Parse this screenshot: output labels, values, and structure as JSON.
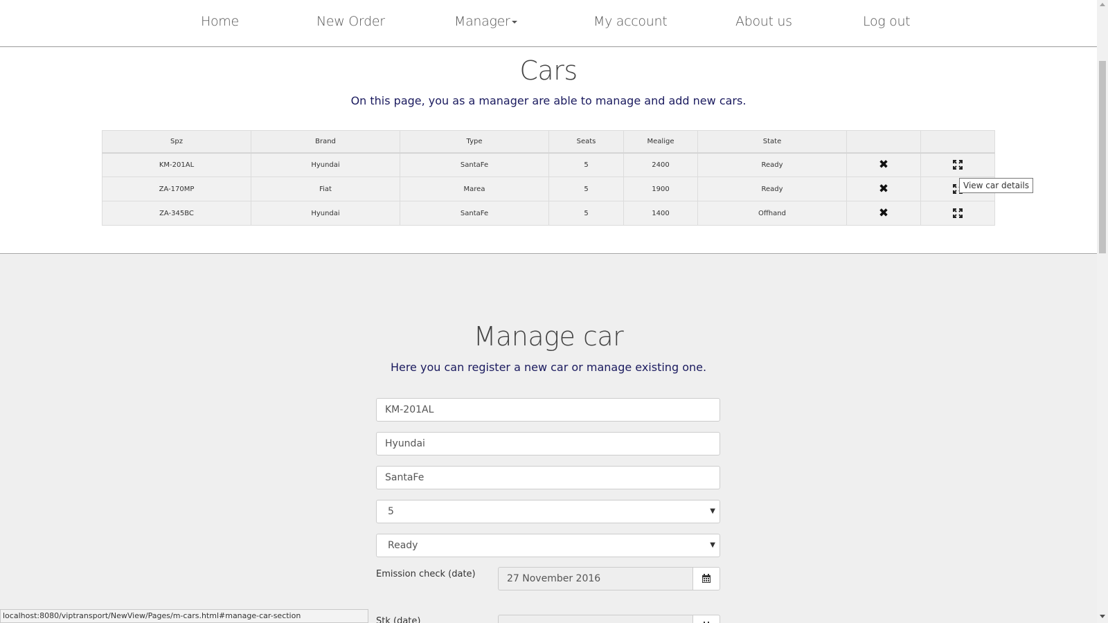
{
  "nav": {
    "home": "Home",
    "new_order": "New Order",
    "manager": "Manager",
    "my_account": "My account",
    "about_us": "About us",
    "log_out": "Log out"
  },
  "cars_section": {
    "title": "Cars",
    "subtitle": "On this page, you as a manager are able to manage and add new cars."
  },
  "table": {
    "headers": [
      "Spz",
      "Brand",
      "Type",
      "Seats",
      "Mealige",
      "State",
      "",
      ""
    ],
    "rows": [
      {
        "spz": "KM-201AL",
        "brand": "Hyundai",
        "type": "SantaFe",
        "seats": "5",
        "mealige": "2400",
        "state": "Ready"
      },
      {
        "spz": "ZA-170MP",
        "brand": "Fiat",
        "type": "Marea",
        "seats": "5",
        "mealige": "1900",
        "state": "Ready"
      },
      {
        "spz": "ZA-345BC",
        "brand": "Hyundai",
        "type": "SantaFe",
        "seats": "5",
        "mealige": "1400",
        "state": "Offhand"
      }
    ],
    "delete_icon": "close-icon",
    "details_icon": "expand-icon"
  },
  "tooltip": "View car details",
  "manage_section": {
    "title": "Manage car",
    "subtitle": "Here you can register a new car or manage existing one.",
    "spz_value": "KM-201AL",
    "brand_value": "Hyundai",
    "type_value": "SantaFe",
    "seats_selected": "5",
    "state_selected": "Ready",
    "emission_label": "Emission check (date)",
    "emission_value": "27 November 2016",
    "stk_label": "Stk (date)",
    "stk_value": ""
  },
  "status_bar": {
    "url": "localhost:8080/viptransport/NewView/Pages/m-cars.html#manage-car-section"
  },
  "colors": {
    "subtitle_text": "#1a1a5e",
    "section_gray": "#efefef",
    "table_cell": "#f1f1f1"
  }
}
